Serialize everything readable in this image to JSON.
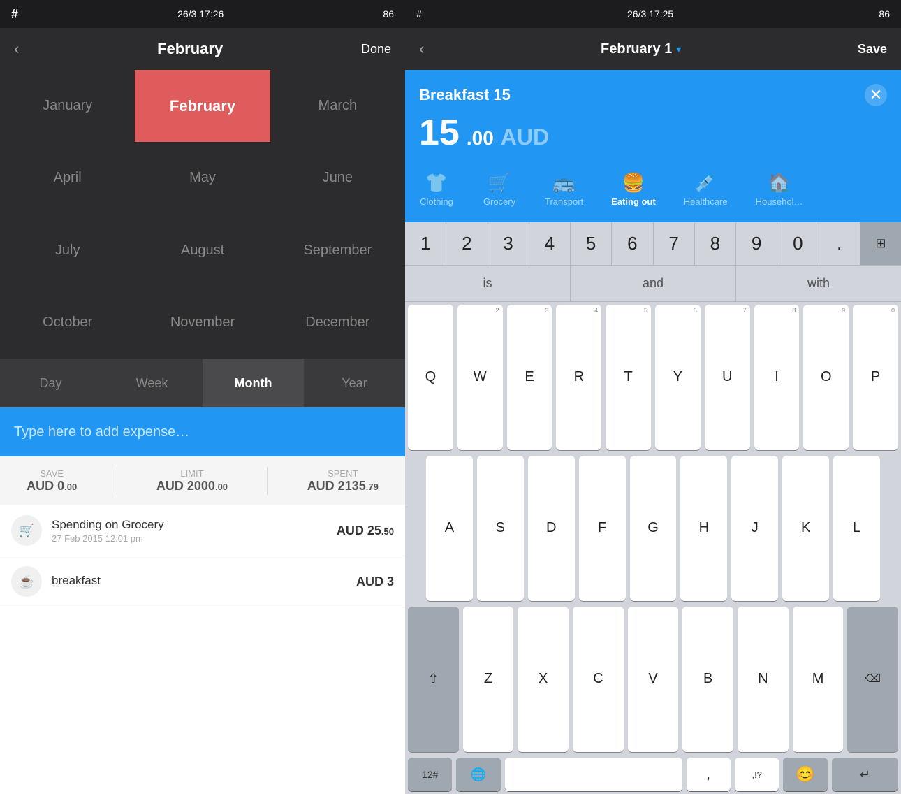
{
  "left": {
    "statusBar": {
      "hashtag": "#",
      "time": "26/3 17:26",
      "battery": "86"
    },
    "navBar": {
      "back": "‹",
      "title": "February",
      "done": "Done"
    },
    "months": [
      {
        "id": "jan",
        "label": "January",
        "selected": false
      },
      {
        "id": "feb",
        "label": "February",
        "selected": true
      },
      {
        "id": "mar",
        "label": "March",
        "selected": false
      },
      {
        "id": "apr",
        "label": "April",
        "selected": false
      },
      {
        "id": "may",
        "label": "May",
        "selected": false
      },
      {
        "id": "jun",
        "label": "June",
        "selected": false
      },
      {
        "id": "jul",
        "label": "July",
        "selected": false
      },
      {
        "id": "aug",
        "label": "August",
        "selected": false
      },
      {
        "id": "sep",
        "label": "September",
        "selected": false
      },
      {
        "id": "oct",
        "label": "October",
        "selected": false
      },
      {
        "id": "nov",
        "label": "November",
        "selected": false
      },
      {
        "id": "dec",
        "label": "December",
        "selected": false
      }
    ],
    "periodTabs": [
      {
        "id": "day",
        "label": "Day",
        "active": false
      },
      {
        "id": "week",
        "label": "Week",
        "active": false
      },
      {
        "id": "month",
        "label": "Month",
        "active": true
      },
      {
        "id": "year",
        "label": "Year",
        "active": false
      }
    ],
    "addExpense": {
      "placeholder": "Type here to add expense…"
    },
    "summary": {
      "save": {
        "label": "Save",
        "value": "AUD 0",
        "decimal": ".00"
      },
      "limit": {
        "label": "Limit",
        "value": "AUD 2000",
        "decimal": ".00"
      },
      "spent": {
        "label": "Spent",
        "value": "AUD 2135",
        "decimal": ".79"
      }
    },
    "expenses": [
      {
        "id": "grocery",
        "icon": "🛒",
        "name": "Spending on Grocery",
        "date": "27 Feb 2015 12:01 pm",
        "amount": "AUD 25",
        "decimal": ".50"
      },
      {
        "id": "breakfast",
        "icon": "☕",
        "name": "breakfast",
        "date": "",
        "amount": "AUD 3",
        "decimal": ""
      }
    ]
  },
  "right": {
    "statusBar": {
      "hashtag": "#",
      "time": "26/3 17:25",
      "battery": "86"
    },
    "navBar": {
      "back": "‹",
      "title": "February 1",
      "dropdownArrow": "▾",
      "save": "Save"
    },
    "expenseHeader": {
      "name": "Breakfast 15",
      "close": "✕",
      "amountMain": "15",
      "amountDecimal": ".00",
      "currency": "AUD"
    },
    "categories": [
      {
        "id": "clothing",
        "icon": "👕",
        "label": "Clothing",
        "active": false
      },
      {
        "id": "grocery",
        "icon": "🛒",
        "label": "Grocery",
        "active": false
      },
      {
        "id": "transport",
        "icon": "🚌",
        "label": "Transport",
        "active": false
      },
      {
        "id": "eating",
        "icon": "🍔",
        "label": "Eating out",
        "active": true
      },
      {
        "id": "healthcare",
        "icon": "💉",
        "label": "Healthcare",
        "active": false
      },
      {
        "id": "household",
        "icon": "🏠",
        "label": "Househol…",
        "active": false
      }
    ],
    "numpad": {
      "keys": [
        "1",
        "2",
        "3",
        "4",
        "5",
        "6",
        "7",
        "8",
        "9",
        "0",
        "."
      ],
      "action": "⊞"
    },
    "suggestions": [
      "is",
      "and",
      "with"
    ],
    "keyboard": {
      "row1": [
        {
          "char": "Q",
          "num": ""
        },
        {
          "char": "W",
          "num": "2"
        },
        {
          "char": "E",
          "num": "3"
        },
        {
          "char": "R",
          "num": "4"
        },
        {
          "char": "T",
          "num": "5"
        },
        {
          "char": "Y",
          "num": "6"
        },
        {
          "char": "U",
          "num": "7"
        },
        {
          "char": "I",
          "num": "8"
        },
        {
          "char": "O",
          "num": "9"
        },
        {
          "char": "P",
          "num": "0"
        }
      ],
      "row2": [
        {
          "char": "A",
          "num": ""
        },
        {
          "char": "S",
          "num": ""
        },
        {
          "char": "D",
          "num": ""
        },
        {
          "char": "F",
          "num": ""
        },
        {
          "char": "G",
          "num": ""
        },
        {
          "char": "H",
          "num": ""
        },
        {
          "char": "J",
          "num": ""
        },
        {
          "char": "K",
          "num": ""
        },
        {
          "char": "L",
          "num": ""
        }
      ],
      "row3": [
        {
          "char": "shift",
          "num": ""
        },
        {
          "char": "Z",
          "num": ""
        },
        {
          "char": "X",
          "num": ""
        },
        {
          "char": "C",
          "num": ""
        },
        {
          "char": "V",
          "num": ""
        },
        {
          "char": "B",
          "num": ""
        },
        {
          "char": "N",
          "num": ""
        },
        {
          "char": "M",
          "num": ""
        },
        {
          "char": "⌫",
          "num": ""
        }
      ],
      "bottomRow": {
        "num": "12#",
        "globe": "🌐",
        "space": "",
        "comma": ",",
        "punct": "!?",
        "emoji": "😊",
        "enter": "↵"
      }
    }
  }
}
